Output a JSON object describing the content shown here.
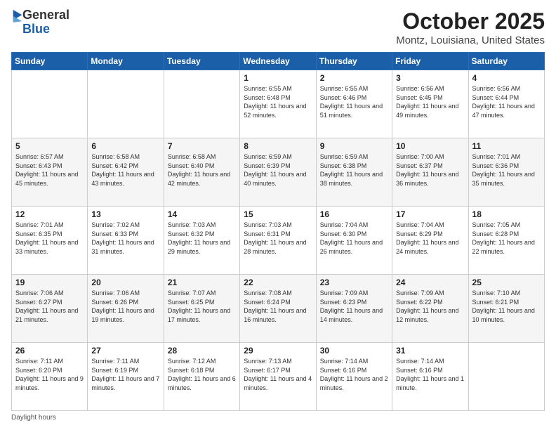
{
  "logo": {
    "general": "General",
    "blue": "Blue"
  },
  "title": "October 2025",
  "location": "Montz, Louisiana, United States",
  "days_of_week": [
    "Sunday",
    "Monday",
    "Tuesday",
    "Wednesday",
    "Thursday",
    "Friday",
    "Saturday"
  ],
  "footer": "Daylight hours",
  "weeks": [
    [
      {
        "day": "",
        "info": ""
      },
      {
        "day": "",
        "info": ""
      },
      {
        "day": "",
        "info": ""
      },
      {
        "day": "1",
        "info": "Sunrise: 6:55 AM\nSunset: 6:48 PM\nDaylight: 11 hours\nand 52 minutes."
      },
      {
        "day": "2",
        "info": "Sunrise: 6:55 AM\nSunset: 6:46 PM\nDaylight: 11 hours\nand 51 minutes."
      },
      {
        "day": "3",
        "info": "Sunrise: 6:56 AM\nSunset: 6:45 PM\nDaylight: 11 hours\nand 49 minutes."
      },
      {
        "day": "4",
        "info": "Sunrise: 6:56 AM\nSunset: 6:44 PM\nDaylight: 11 hours\nand 47 minutes."
      }
    ],
    [
      {
        "day": "5",
        "info": "Sunrise: 6:57 AM\nSunset: 6:43 PM\nDaylight: 11 hours\nand 45 minutes."
      },
      {
        "day": "6",
        "info": "Sunrise: 6:58 AM\nSunset: 6:42 PM\nDaylight: 11 hours\nand 43 minutes."
      },
      {
        "day": "7",
        "info": "Sunrise: 6:58 AM\nSunset: 6:40 PM\nDaylight: 11 hours\nand 42 minutes."
      },
      {
        "day": "8",
        "info": "Sunrise: 6:59 AM\nSunset: 6:39 PM\nDaylight: 11 hours\nand 40 minutes."
      },
      {
        "day": "9",
        "info": "Sunrise: 6:59 AM\nSunset: 6:38 PM\nDaylight: 11 hours\nand 38 minutes."
      },
      {
        "day": "10",
        "info": "Sunrise: 7:00 AM\nSunset: 6:37 PM\nDaylight: 11 hours\nand 36 minutes."
      },
      {
        "day": "11",
        "info": "Sunrise: 7:01 AM\nSunset: 6:36 PM\nDaylight: 11 hours\nand 35 minutes."
      }
    ],
    [
      {
        "day": "12",
        "info": "Sunrise: 7:01 AM\nSunset: 6:35 PM\nDaylight: 11 hours\nand 33 minutes."
      },
      {
        "day": "13",
        "info": "Sunrise: 7:02 AM\nSunset: 6:33 PM\nDaylight: 11 hours\nand 31 minutes."
      },
      {
        "day": "14",
        "info": "Sunrise: 7:03 AM\nSunset: 6:32 PM\nDaylight: 11 hours\nand 29 minutes."
      },
      {
        "day": "15",
        "info": "Sunrise: 7:03 AM\nSunset: 6:31 PM\nDaylight: 11 hours\nand 28 minutes."
      },
      {
        "day": "16",
        "info": "Sunrise: 7:04 AM\nSunset: 6:30 PM\nDaylight: 11 hours\nand 26 minutes."
      },
      {
        "day": "17",
        "info": "Sunrise: 7:04 AM\nSunset: 6:29 PM\nDaylight: 11 hours\nand 24 minutes."
      },
      {
        "day": "18",
        "info": "Sunrise: 7:05 AM\nSunset: 6:28 PM\nDaylight: 11 hours\nand 22 minutes."
      }
    ],
    [
      {
        "day": "19",
        "info": "Sunrise: 7:06 AM\nSunset: 6:27 PM\nDaylight: 11 hours\nand 21 minutes."
      },
      {
        "day": "20",
        "info": "Sunrise: 7:06 AM\nSunset: 6:26 PM\nDaylight: 11 hours\nand 19 minutes."
      },
      {
        "day": "21",
        "info": "Sunrise: 7:07 AM\nSunset: 6:25 PM\nDaylight: 11 hours\nand 17 minutes."
      },
      {
        "day": "22",
        "info": "Sunrise: 7:08 AM\nSunset: 6:24 PM\nDaylight: 11 hours\nand 16 minutes."
      },
      {
        "day": "23",
        "info": "Sunrise: 7:09 AM\nSunset: 6:23 PM\nDaylight: 11 hours\nand 14 minutes."
      },
      {
        "day": "24",
        "info": "Sunrise: 7:09 AM\nSunset: 6:22 PM\nDaylight: 11 hours\nand 12 minutes."
      },
      {
        "day": "25",
        "info": "Sunrise: 7:10 AM\nSunset: 6:21 PM\nDaylight: 11 hours\nand 10 minutes."
      }
    ],
    [
      {
        "day": "26",
        "info": "Sunrise: 7:11 AM\nSunset: 6:20 PM\nDaylight: 11 hours\nand 9 minutes."
      },
      {
        "day": "27",
        "info": "Sunrise: 7:11 AM\nSunset: 6:19 PM\nDaylight: 11 hours\nand 7 minutes."
      },
      {
        "day": "28",
        "info": "Sunrise: 7:12 AM\nSunset: 6:18 PM\nDaylight: 11 hours\nand 6 minutes."
      },
      {
        "day": "29",
        "info": "Sunrise: 7:13 AM\nSunset: 6:17 PM\nDaylight: 11 hours\nand 4 minutes."
      },
      {
        "day": "30",
        "info": "Sunrise: 7:14 AM\nSunset: 6:16 PM\nDaylight: 11 hours\nand 2 minutes."
      },
      {
        "day": "31",
        "info": "Sunrise: 7:14 AM\nSunset: 6:16 PM\nDaylight: 11 hours\nand 1 minute."
      },
      {
        "day": "",
        "info": ""
      }
    ]
  ]
}
